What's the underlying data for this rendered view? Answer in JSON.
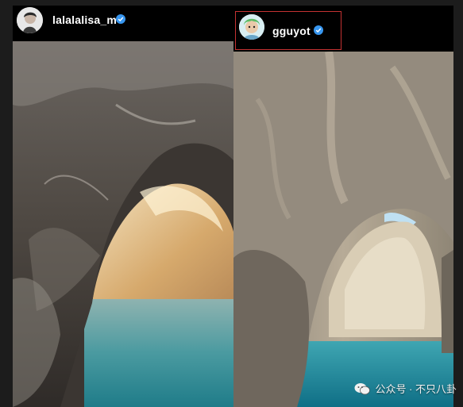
{
  "posts": [
    {
      "username": "lalalalisa_m",
      "verified": true,
      "avatar_icon": "profile-photo"
    },
    {
      "username": "gguyot",
      "verified": true,
      "avatar_icon": "cartoon-avatar-green-hair",
      "highlighted": true
    }
  ],
  "watermark": {
    "icon": "wechat-icon",
    "text": "公众号 · 不只八卦"
  },
  "colors": {
    "verified_badge": "#3897f0",
    "highlight_border": "#c43232",
    "background": "#1c1c1c"
  }
}
